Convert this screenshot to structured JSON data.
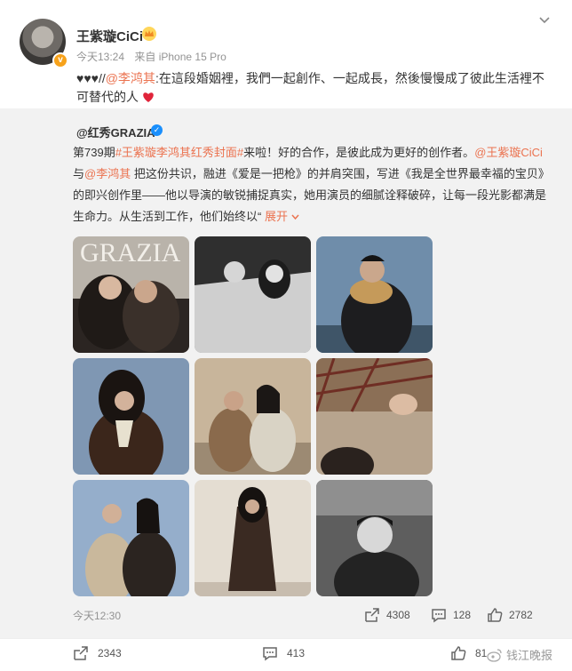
{
  "post": {
    "author": "王紫璇CiCi",
    "time": "今天13:24",
    "source": "来自 iPhone 15 Pro",
    "text_prefix": "♥♥♥//",
    "mention": "@李鸿其",
    "text_body": ":在這段婚姻裡，我們一起創作、一起成長，然後慢慢成了彼此生活裡不可替代的人"
  },
  "repost": {
    "author": "@红秀GRAZIA",
    "t1": "第739期",
    "topic": "#王紫璇李鸿其红秀封面#",
    "t2": "来啦！好的合作，是彼此成为更好的创作者。",
    "m1": "@王紫璇CiCi",
    "t3": " 与",
    "m2": "@李鸿其",
    "t4": " 把这份共识，融进《爱是一把枪》的并肩突围，写进《我是全世界最幸福的宝贝》的即兴创作里——他以导演的敏锐捕捉真实，她用演员的细腻诠释破碎，让每一段光影都满是生命力。从生活到工作，他们始终以“",
    "expand": "展开",
    "cover_text": "GRAZIA",
    "time": "今天12:30",
    "shares": "4308",
    "comments": "128",
    "likes": "2782"
  },
  "bottom": {
    "shares": "2343",
    "comments": "413",
    "likes": "81",
    "watermark": "钱江晚报"
  },
  "colors": {
    "link": "#eb7350",
    "orange": "#f7a21b",
    "blue": "#1a8ffc"
  }
}
